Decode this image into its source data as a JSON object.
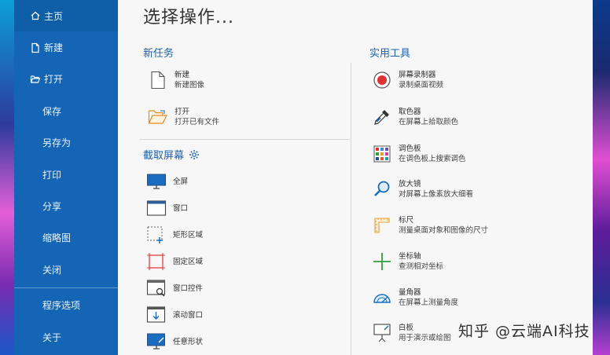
{
  "sidebar": {
    "items": [
      {
        "label": "主页",
        "icon": "home-icon"
      },
      {
        "label": "新建",
        "icon": "new-file-icon"
      },
      {
        "label": "打开",
        "icon": "folder-open-icon"
      },
      {
        "label": "保存"
      },
      {
        "label": "另存为"
      },
      {
        "label": "打印"
      },
      {
        "label": "分享"
      },
      {
        "label": "缩略图"
      },
      {
        "label": "关闭"
      },
      {
        "label": "程序选项"
      },
      {
        "label": "关于"
      }
    ]
  },
  "main": {
    "title": "选择操作...",
    "new_task": {
      "title": "新任务",
      "items": [
        {
          "title": "新建",
          "subtitle": "新建图像"
        },
        {
          "title": "打开",
          "subtitle": "打开已有文件"
        }
      ]
    },
    "capture": {
      "title": "截取屏幕",
      "items": [
        {
          "title": "全屏"
        },
        {
          "title": "窗口"
        },
        {
          "title": "矩形区域"
        },
        {
          "title": "固定区域"
        },
        {
          "title": "窗口控件"
        },
        {
          "title": "滚动窗口"
        },
        {
          "title": "任意形状"
        }
      ]
    },
    "tools": {
      "title": "实用工具",
      "items": [
        {
          "title": "屏幕录制器",
          "subtitle": "录制桌面视频"
        },
        {
          "title": "取色器",
          "subtitle": "在屏幕上拾取颜色"
        },
        {
          "title": "调色板",
          "subtitle": "在调色板上搜索调色"
        },
        {
          "title": "放大镜",
          "subtitle": "对屏幕上像素放大细看"
        },
        {
          "title": "标尺",
          "subtitle": "测量桌面对象和图像的尺寸"
        },
        {
          "title": "坐标轴",
          "subtitle": "查测相对坐标"
        },
        {
          "title": "量角器",
          "subtitle": "在屏幕上测量角度"
        },
        {
          "title": "白板",
          "subtitle": "用于演示或绘图"
        }
      ]
    }
  },
  "watermark": "知乎 @云端AI科技",
  "colors": {
    "sidebar": "#1565b6",
    "accent": "#1a60b0",
    "panel": "#f7f7f7"
  }
}
